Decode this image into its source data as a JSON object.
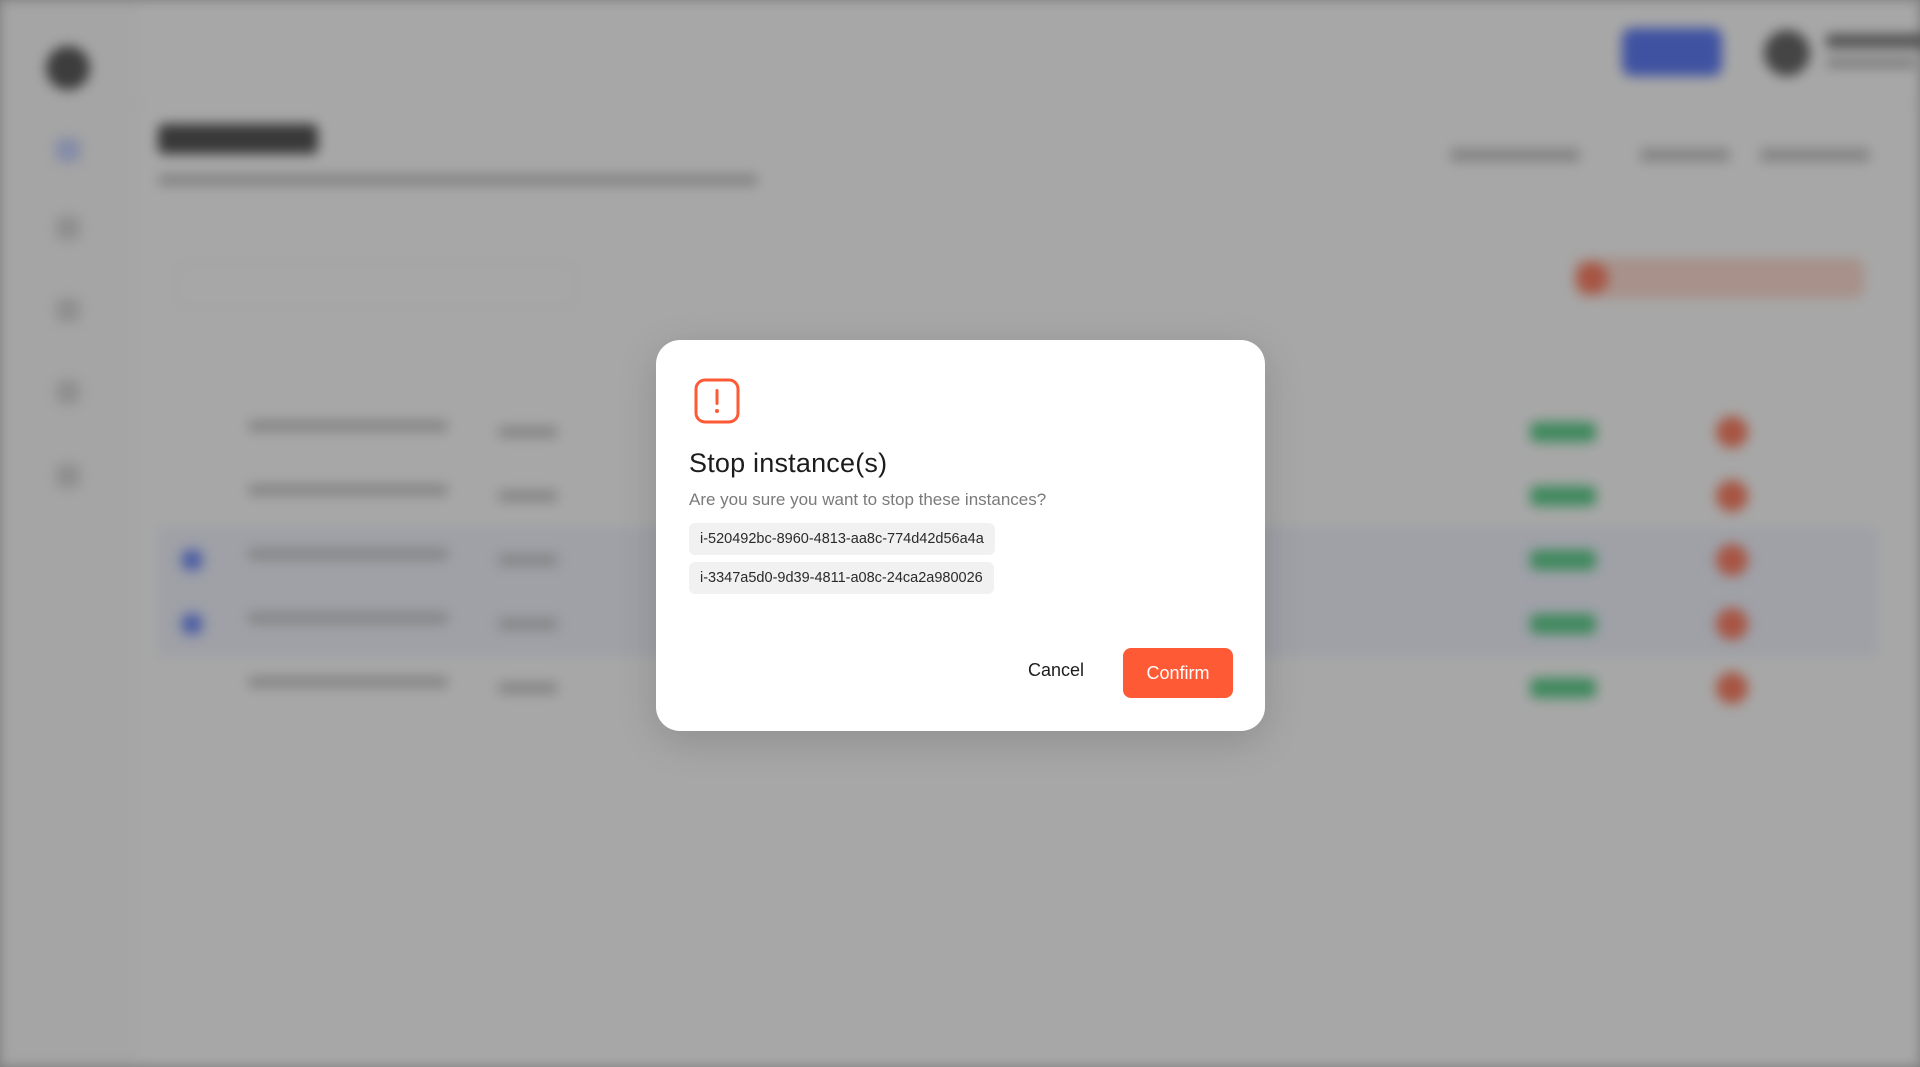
{
  "colors": {
    "accent_danger": "#ff5a36",
    "primary_blue": "#2f55f3",
    "status_green": "#2fc26b"
  },
  "modal": {
    "icon": "alert-square-icon",
    "title": "Stop instance(s)",
    "description": "Are you sure you want to stop these instances?",
    "instance_ids": [
      "i-520492bc-8960-4813-aa8c-774d42d56a4a",
      "i-3347a5d0-9d39-4811-a08c-24ca2a980026"
    ],
    "cancel_label": "Cancel",
    "confirm_label": "Confirm"
  }
}
